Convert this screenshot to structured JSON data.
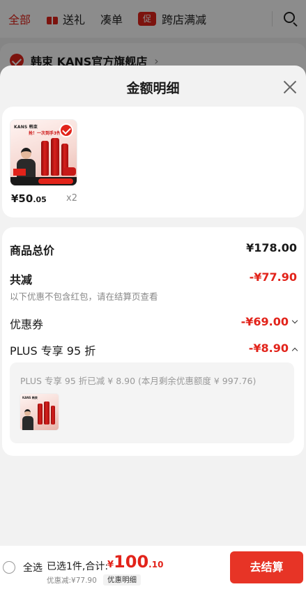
{
  "background": {
    "tabs": [
      {
        "label": "全部"
      },
      {
        "label": "送礼"
      },
      {
        "label": "凑单"
      },
      {
        "label": "跨店满减",
        "badge": "促"
      }
    ],
    "store_name": "韩束 KANS官方旗舰店",
    "store_chevron": "›"
  },
  "sheet": {
    "title": "金额明细",
    "product": {
      "thumb_brand": "KANS 韩束",
      "thumb_tagline": "抢！一次到手3件好",
      "price_main": "¥50",
      "price_decimal": ".05",
      "quantity": "x2"
    },
    "detail": {
      "goods_total_label": "商品总价",
      "goods_total_value": "¥178.00",
      "total_discount_label": "共减",
      "total_discount_value": "-¥77.90",
      "note": "以下优惠不包含红包，请在结算页查看",
      "coupon_label": "优惠券",
      "coupon_value": "-¥69.00",
      "plus_label": "PLUS 专享 95 折",
      "plus_value": "-¥8.90",
      "plus_box_text": "PLUS 专享 95 折已减 ¥ 8.90 (本月剩余优惠额度 ¥ 997.76)"
    }
  },
  "bottom": {
    "select_all": "全选",
    "summary": "已选1件,合计:",
    "total_currency": "¥",
    "total_int": "100",
    "total_dec": ".10",
    "saved": "优惠减:¥77.90",
    "detail_link": "优惠明细",
    "checkout": "去结算"
  },
  "colors": {
    "accent": "#e2231a",
    "checkout_button": "#e73426",
    "muted_text": "#888888"
  },
  "icons": [
    "gift-icon",
    "search-icon",
    "check-icon",
    "close-icon",
    "chevron-down-icon",
    "chevron-up-icon",
    "radio-icon"
  ]
}
